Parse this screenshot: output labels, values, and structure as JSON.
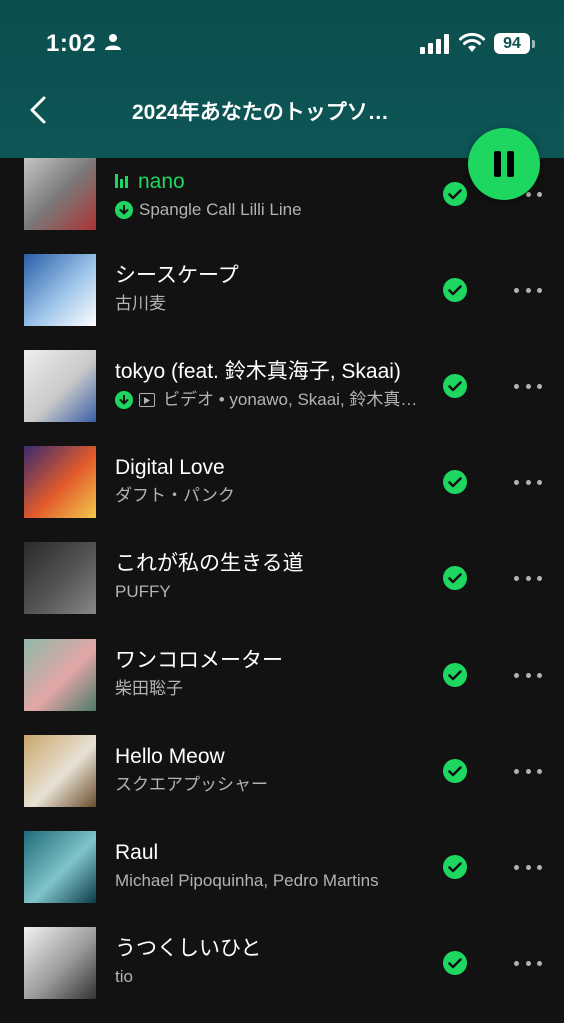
{
  "status_bar": {
    "time": "1:02",
    "battery": "94"
  },
  "header": {
    "title": "2024年あなたのトップソ…"
  },
  "tracks": [
    {
      "title": "nano",
      "subtitle": "Spangle Call Lilli Line",
      "playing": true,
      "downloaded": true,
      "video": false,
      "art_colors": [
        "#d8d8d8",
        "#7a7a7a",
        "#a33"
      ]
    },
    {
      "title": "シースケープ",
      "subtitle": "古川麦",
      "playing": false,
      "downloaded": false,
      "video": false,
      "art_colors": [
        "#2a5fa8",
        "#9cc4ea",
        "#ffffff"
      ]
    },
    {
      "title": "tokyo (feat. 鈴木真海子, Skaai)",
      "subtitle": "ビデオ • yonawo, Skaai, 鈴木真海子",
      "playing": false,
      "downloaded": true,
      "video": true,
      "art_colors": [
        "#eeeeee",
        "#c9c9c9",
        "#3a5fa8"
      ]
    },
    {
      "title": "Digital Love",
      "subtitle": "ダフト・パンク",
      "playing": false,
      "downloaded": false,
      "video": false,
      "art_colors": [
        "#3b2b6e",
        "#e25b2b",
        "#f2c94c"
      ]
    },
    {
      "title": "これが私の生きる道",
      "subtitle": "PUFFY",
      "playing": false,
      "downloaded": false,
      "video": false,
      "art_colors": [
        "#2a2a2a",
        "#555555",
        "#888888"
      ]
    },
    {
      "title": "ワンコロメーター",
      "subtitle": "柴田聡子",
      "playing": false,
      "downloaded": false,
      "video": false,
      "art_colors": [
        "#8fb8a8",
        "#e3a6a6",
        "#4d7a6a"
      ]
    },
    {
      "title": "Hello Meow",
      "subtitle": "スクエアプッシャー",
      "playing": false,
      "downloaded": false,
      "video": false,
      "art_colors": [
        "#c9a66b",
        "#e8e2d5",
        "#6b4d2b"
      ]
    },
    {
      "title": "Raul",
      "subtitle": "Michael Pipoquinha, Pedro Martins",
      "playing": false,
      "downloaded": false,
      "video": false,
      "art_colors": [
        "#1f6b7a",
        "#7fc4c9",
        "#0d3b47"
      ]
    },
    {
      "title": "うつくしいひと",
      "subtitle": "tio",
      "playing": false,
      "downloaded": false,
      "video": false,
      "art_colors": [
        "#f2f2f2",
        "#9a9a9a",
        "#333333"
      ]
    }
  ],
  "colors": {
    "accent": "#1ed760",
    "header_bg": "#0e5454",
    "background": "#121212",
    "secondary_text": "#b3b3b3"
  }
}
